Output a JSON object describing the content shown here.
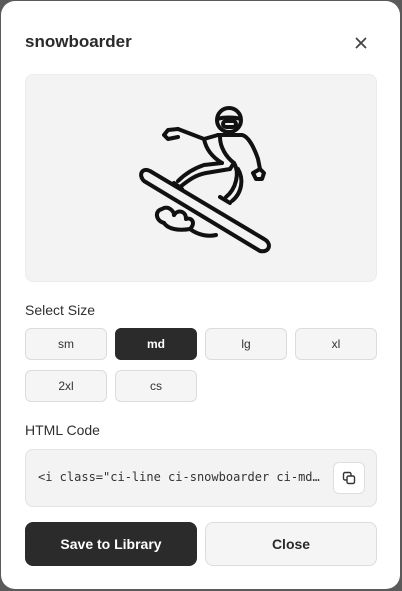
{
  "dialog": {
    "title": "snowboarder",
    "close_icon": "close-icon"
  },
  "preview": {
    "icon": "snowboarder-icon"
  },
  "size": {
    "label": "Select Size",
    "options": [
      "sm",
      "md",
      "lg",
      "xl",
      "2xl",
      "cs"
    ],
    "selected": "md"
  },
  "code": {
    "label": "HTML Code",
    "value": "<i class=\"ci-line ci-snowboarder ci-md\"></i>",
    "copy_icon": "copy-icon"
  },
  "actions": {
    "save_label": "Save to Library",
    "close_label": "Close"
  },
  "colors": {
    "primary": "#2b2b2b",
    "surface": "#f3f3f3"
  }
}
